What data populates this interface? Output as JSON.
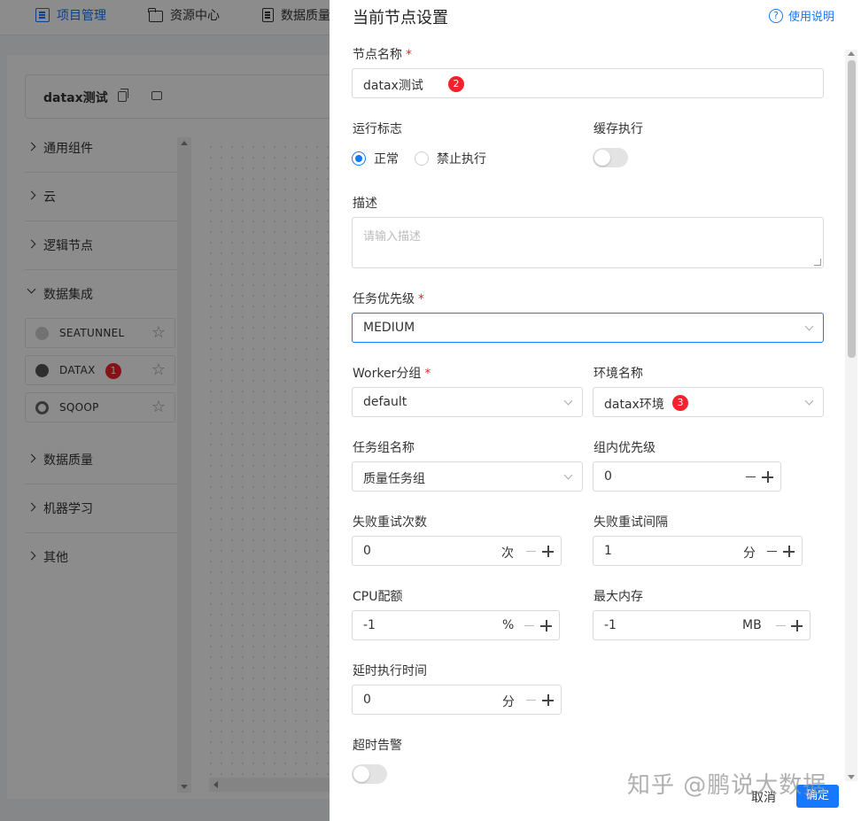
{
  "topnav": {
    "items": [
      {
        "label": "项目管理",
        "icon": "list-icon",
        "active": true
      },
      {
        "label": "资源中心",
        "icon": "folder-icon"
      },
      {
        "label": "数据质量",
        "icon": "document-icon"
      }
    ]
  },
  "workflow": {
    "title": "datax测试"
  },
  "sidebar": {
    "groups": [
      {
        "label": "通用组件",
        "expanded": false
      },
      {
        "label": "云",
        "expanded": false
      },
      {
        "label": "逻辑节点",
        "expanded": false
      },
      {
        "label": "数据集成",
        "expanded": true
      },
      {
        "label": "数据质量",
        "expanded": false
      },
      {
        "label": "机器学习",
        "expanded": false
      },
      {
        "label": "其他",
        "expanded": false
      }
    ],
    "components": [
      {
        "label": "SEATUNNEL",
        "icon": "seatunnel-icon"
      },
      {
        "label": "DATAX",
        "icon": "datax-icon",
        "badge": "1"
      },
      {
        "label": "SQOOP",
        "icon": "sqoop-icon"
      }
    ]
  },
  "drawer": {
    "title": "当前节点设置",
    "help": "使用说明",
    "node_name": {
      "label": "节点名称",
      "value": "datax测试",
      "badge": "2"
    },
    "run_flag": {
      "label": "运行标志",
      "options": [
        "正常",
        "禁止执行"
      ],
      "selected": "正常"
    },
    "cache_exec": {
      "label": "缓存执行",
      "enabled": false
    },
    "description": {
      "label": "描述",
      "placeholder": "请输入描述"
    },
    "priority": {
      "label": "任务优先级",
      "value": "MEDIUM"
    },
    "worker_group": {
      "label": "Worker分组",
      "value": "default"
    },
    "env_name": {
      "label": "环境名称",
      "value": "datax环境",
      "badge": "3"
    },
    "task_group": {
      "label": "任务组名称",
      "value": "质量任务组"
    },
    "group_priority": {
      "label": "组内优先级",
      "value": "0"
    },
    "retry_times": {
      "label": "失败重试次数",
      "value": "0",
      "unit": "次"
    },
    "retry_interval": {
      "label": "失败重试间隔",
      "value": "1",
      "unit": "分"
    },
    "cpu_quota": {
      "label": "CPU配额",
      "value": "-1",
      "unit": "%"
    },
    "max_memory": {
      "label": "最大内存",
      "value": "-1",
      "unit": "MB"
    },
    "delay_time": {
      "label": "延时执行时间",
      "value": "0",
      "unit": "分"
    },
    "timeout_alarm": {
      "label": "超时告警",
      "enabled": false
    },
    "cancel_label": "取消",
    "confirm_label": "确定"
  },
  "watermark": "知乎 @鹏说大数据",
  "colors": {
    "primary": "#1677ff",
    "required": "#f5222d",
    "badge": "#f5222d"
  }
}
